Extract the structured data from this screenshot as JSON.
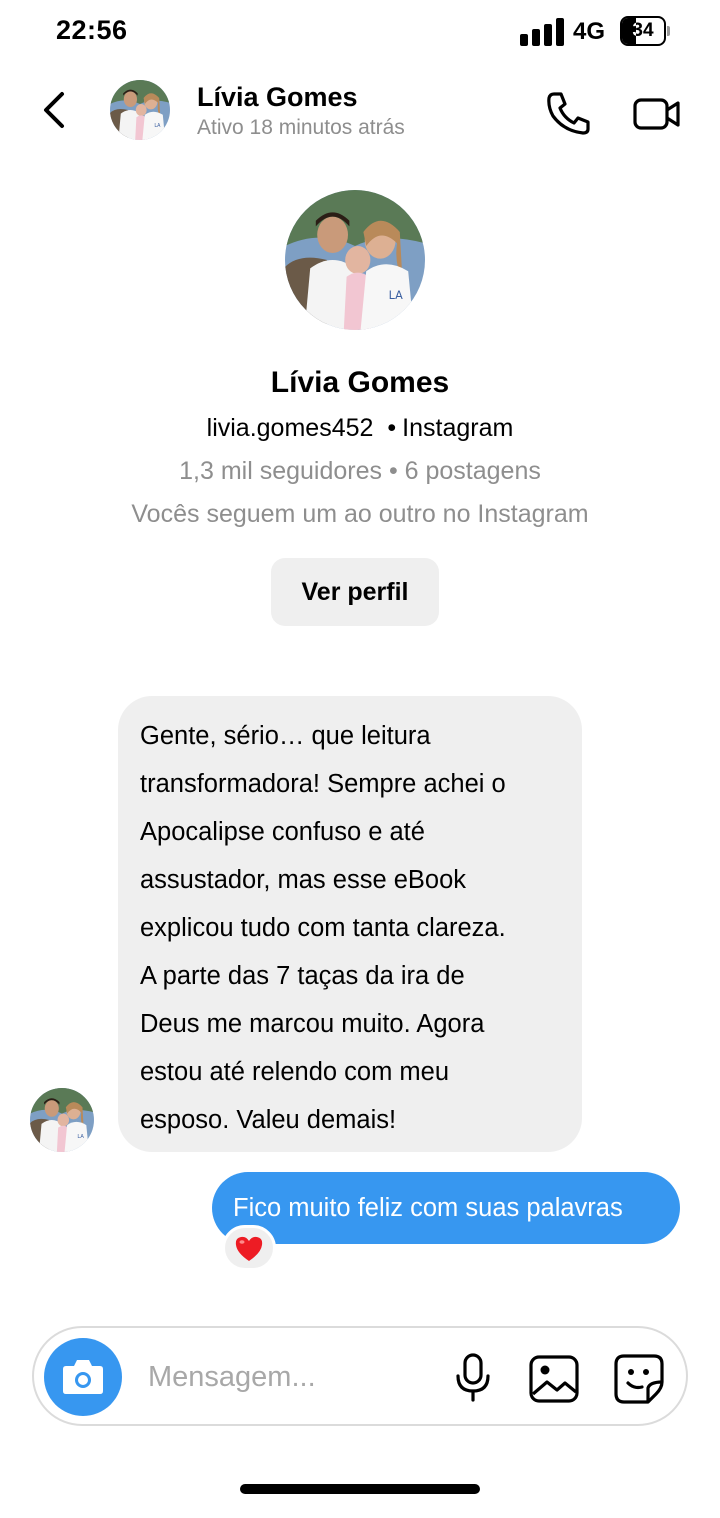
{
  "status_bar": {
    "time": "22:56",
    "network": "4G",
    "battery": "34",
    "battery_level_pct": 34
  },
  "header": {
    "name": "Lívia Gomes",
    "status": "Ativo 18 minutos atrás",
    "icons": {
      "back": "chevron-left-icon",
      "call": "phone-icon",
      "video": "video-camera-icon"
    }
  },
  "profile": {
    "name": "Lívia Gomes",
    "handle": "livia.gomes452",
    "separator": "•",
    "platform": "Instagram",
    "stats": "1,3 mil seguidores • 6 postagens",
    "mutual": "Vocês seguem um ao outro no Instagram",
    "view_profile_label": "Ver perfil"
  },
  "messages": [
    {
      "from": "other",
      "lines": [
        "Gente, sério… que leitura",
        "transformadora! Sempre achei o",
        "Apocalipse confuso e até",
        "assustador, mas esse eBook",
        "explicou tudo com tanta clareza.",
        "A parte das 7 taças da ira de",
        "Deus me marcou muito. Agora",
        "estou até relendo com meu",
        "esposo. Valeu demais!"
      ]
    },
    {
      "from": "me",
      "text": "Fico muito feliz com suas palavras",
      "reaction": "heart-icon"
    }
  ],
  "composer": {
    "placeholder": "Mensagem...",
    "icons": {
      "camera": "camera-icon",
      "mic": "microphone-icon",
      "gallery": "image-icon",
      "sticker": "sticker-icon"
    }
  },
  "colors": {
    "accent": "#3797f0",
    "bubble_gray": "#efefef",
    "muted_text": "#8e8e8e",
    "heart": "#ed1c24"
  }
}
